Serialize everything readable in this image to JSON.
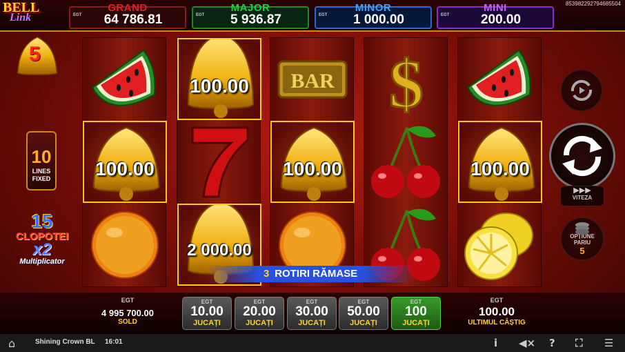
{
  "session_id": "853982292794685504",
  "logo": {
    "line1": "BELL",
    "line2": "Link"
  },
  "bell_counter": "5",
  "jackpots": {
    "egt": "EGT",
    "grand": {
      "name": "GRAND",
      "value": "64 786.81"
    },
    "major": {
      "name": "MAJOR",
      "value": "5 936.87"
    },
    "minor": {
      "name": "MINOR",
      "value": "1 000.00"
    },
    "mini": {
      "name": "MINI",
      "value": "200.00"
    }
  },
  "lines": {
    "number": "10",
    "line1": "LINES",
    "line2": "FIXED"
  },
  "promo": {
    "number": "15",
    "word": "CLOPOTEI",
    "mult": "x2",
    "sub": "Multiplicator"
  },
  "reels": {
    "r1": {
      "c0": "watermelon",
      "c1": "100.00",
      "c2": "orange"
    },
    "r2": {
      "c0": "100.00",
      "c1": "seven",
      "c2": "2 000.00"
    },
    "r3": {
      "c0": "BAR",
      "c1": "100.00",
      "c2": "orange"
    },
    "r4": {
      "c0": "dollar",
      "c1": "cherry",
      "c2": "cherry"
    },
    "r5": {
      "c0": "watermelon",
      "c1": "100.00",
      "c2": "lemon"
    }
  },
  "remaining_spins": {
    "count": "3",
    "label": "ROTIRI RĂMASE"
  },
  "controls": {
    "speed_label": "VITEZA",
    "bet_options_label1": "OPȚIUNE",
    "bet_options_label2": "PARIU",
    "bet_options_value": "5"
  },
  "credit": {
    "egt": "EGT",
    "amount": "4 995 700.00",
    "label": "SOLD"
  },
  "bets": [
    {
      "egt": "EGT",
      "amount": "10.00",
      "label": "JUCAȚI",
      "active": false
    },
    {
      "egt": "EGT",
      "amount": "20.00",
      "label": "JUCAȚI",
      "active": false
    },
    {
      "egt": "EGT",
      "amount": "30.00",
      "label": "JUCAȚI",
      "active": false
    },
    {
      "egt": "EGT",
      "amount": "50.00",
      "label": "JUCAȚI",
      "active": false
    },
    {
      "egt": "EGT",
      "amount": "100",
      "label": "JUCAȚI",
      "active": true
    }
  ],
  "last_win": {
    "egt": "EGT",
    "amount": "100.00",
    "label": "ULTIMUL CÂȘTIG"
  },
  "footer": {
    "game_name": "Shining Crown BL",
    "clock": "16:01"
  },
  "icons": {
    "home": "home-icon",
    "info": "info-icon",
    "sound": "sound-muted-icon",
    "help": "help-icon",
    "fullscreen": "fullscreen-icon",
    "menu": "menu-icon"
  },
  "colors": {
    "grand": "#e02020",
    "major": "#20d040",
    "minor": "#40a0ff",
    "mini": "#c060ff",
    "active_bet": "#3a9a2a",
    "gold": "#ffd23a"
  }
}
